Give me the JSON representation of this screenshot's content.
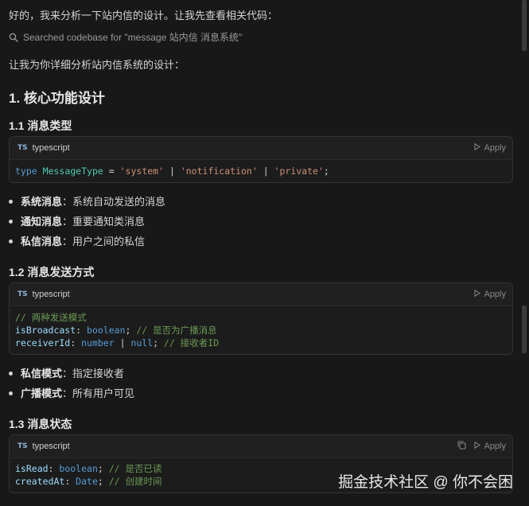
{
  "intro": "好的，我来分析一下站内信的设计。让我先查看相关代码：",
  "search_text": "Searched codebase for \"message 站内信 消息系统\"",
  "lead": "让我为你详细分析站内信系统的设计：",
  "section1_title": "1. 核心功能设计",
  "sub1_title": "1.1 消息类型",
  "sub2_title": "1.2 消息发送方式",
  "sub3_title": "1.3 消息状态",
  "code_blocks": [
    {
      "lang_badge": "TS",
      "lang": "typescript",
      "apply_label": "Apply"
    },
    {
      "lang_badge": "TS",
      "lang": "typescript",
      "apply_label": "Apply"
    },
    {
      "lang_badge": "TS",
      "lang": "typescript",
      "apply_label": "Apply"
    }
  ],
  "code1": {
    "t1": "type",
    "t2": "MessageType",
    "t3": "=",
    "t4": "'system'",
    "t5": "|",
    "t6": "'notification'",
    "t7": "|",
    "t8": "'private'",
    "t9": ";"
  },
  "code2": {
    "l1": "// 两种发送模式",
    "l2a": "isBroadcast",
    "l2b": ": ",
    "l2c": "boolean",
    "l2d": "; ",
    "l2e": "// 是否为广播消息",
    "l3a": "receiverId",
    "l3b": ": ",
    "l3c": "number",
    "l3d": " | ",
    "l3e": "null",
    "l3f": "; ",
    "l3g": "// 接收者ID"
  },
  "code3": {
    "l1a": "isRead",
    "l1b": ": ",
    "l1c": "boolean",
    "l1d": "; ",
    "l1e": "// 是否已读",
    "l2a": "createdAt",
    "l2b": ": ",
    "l2c": "Date",
    "l2d": "; ",
    "l2e": "// 创建时间"
  },
  "bullets_types": [
    {
      "bold": "系统消息",
      "text": "：系统自动发送的消息"
    },
    {
      "bold": "通知消息",
      "text": "：重要通知类消息"
    },
    {
      "bold": "私信消息",
      "text": "：用户之间的私信"
    }
  ],
  "bullets_send": [
    {
      "bold": "私信模式",
      "text": "：指定接收者"
    },
    {
      "bold": "广播模式",
      "text": "：所有用户可见"
    }
  ],
  "watermark": "掘金技术社区 @ 你不会困",
  "colors": {
    "background": "#181818",
    "keyword": "#569cd6",
    "type": "#4ec9b0",
    "string": "#ce9178",
    "comment": "#6a9955",
    "identifier": "#9cdcfe"
  }
}
